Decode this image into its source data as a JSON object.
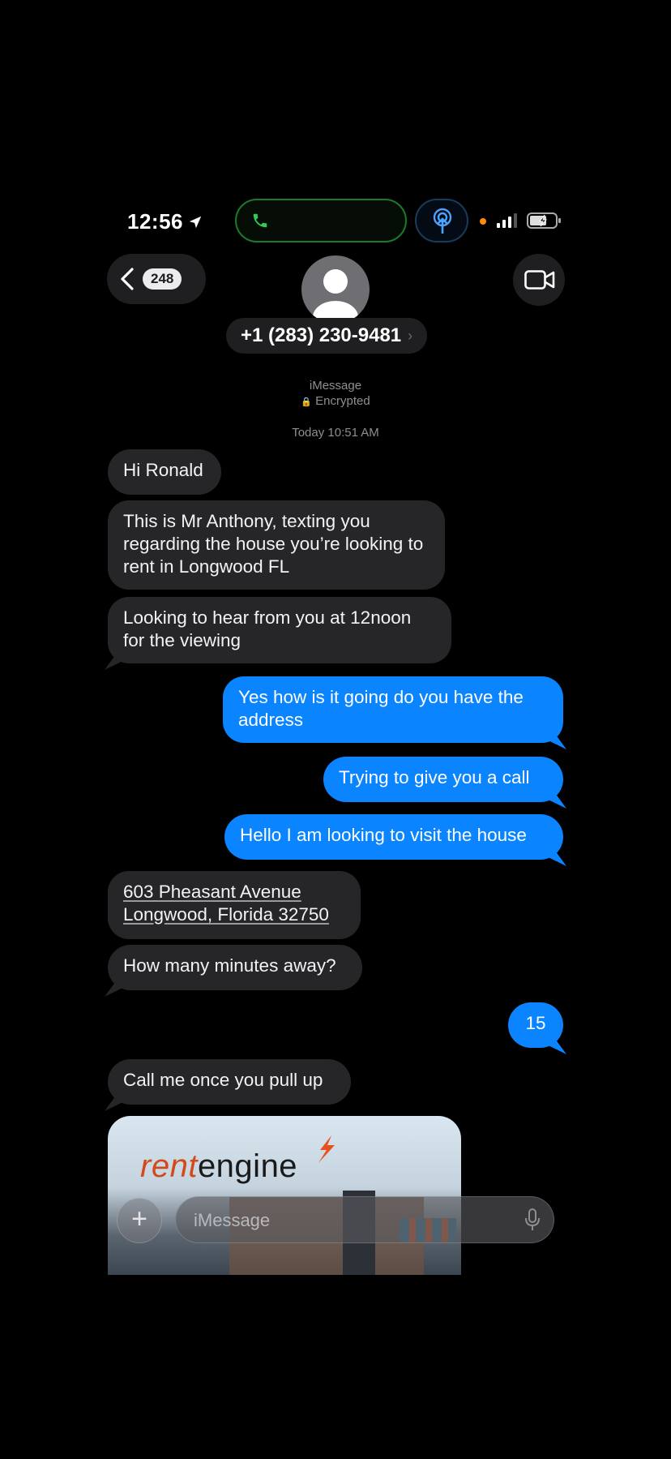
{
  "status_bar": {
    "time": "12:56"
  },
  "nav": {
    "unread_count": "248",
    "contact": "+1 (283) 230-9481",
    "contact_chevron": "›"
  },
  "conversation": {
    "service": "iMessage",
    "encryption": "Encrypted",
    "timestamp": "Today 10:51 AM"
  },
  "messages": [
    {
      "from": "them",
      "text": "Hi Ronald"
    },
    {
      "from": "them",
      "text": "This is Mr Anthony, texting you regarding the house you’re looking to rent in Longwood FL"
    },
    {
      "from": "them",
      "text": "Looking to hear from you at 12noon for the viewing"
    },
    {
      "from": "me",
      "text": "Yes how is it going do you have the address"
    },
    {
      "from": "me",
      "text": "Trying to give you a call"
    },
    {
      "from": "me",
      "text": "Hello I am looking to visit the house"
    },
    {
      "from": "them",
      "text_line1": "603 Pheasant Avenue",
      "text_line2": "Longwood, Florida 32750"
    },
    {
      "from": "them",
      "text": "How many minutes away?"
    },
    {
      "from": "me",
      "text": "15"
    },
    {
      "from": "them",
      "text": "Call me once you pull up"
    }
  ],
  "link_preview": {
    "logo_part1": "rent",
    "logo_part2": "engine"
  },
  "composer": {
    "plus": "+",
    "placeholder": "iMessage"
  },
  "colors": {
    "outgoing": "#0a84ff",
    "incoming": "#262628",
    "background": "#000000",
    "accent_orange": "#d24a1c"
  }
}
